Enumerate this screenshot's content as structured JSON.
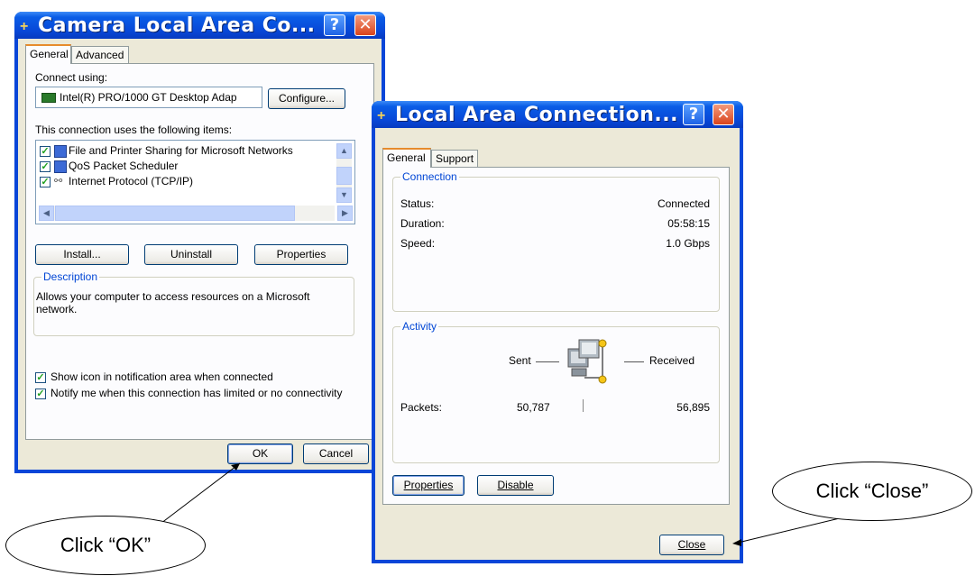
{
  "dialog1": {
    "title": "Camera Local Area Co...",
    "help_label": "?",
    "close_label": "✕",
    "tabs": [
      "General",
      "Advanced"
    ],
    "connect_using_label": "Connect using:",
    "adapter_name": "Intel(R) PRO/1000 GT Desktop Adap",
    "configure_label": "Configure...",
    "items_label": "This connection uses the following items:",
    "items": [
      "File and Printer Sharing for Microsoft Networks",
      "QoS Packet Scheduler",
      "Internet Protocol (TCP/IP)"
    ],
    "install_label": "Install...",
    "uninstall_label": "Uninstall",
    "properties_label": "Properties",
    "description_title": "Description",
    "description_text_line1": "Allows your computer to access resources on a Microsoft",
    "description_text_line2": "network.",
    "show_icon_label": "Show icon in notification area when connected",
    "notify_label": "Notify me when this connection has limited or no connectivity",
    "ok_label": "OK",
    "cancel_label": "Cancel"
  },
  "dialog2": {
    "title": "Local Area Connection...",
    "help_label": "?",
    "close_label": "✕",
    "tabs": [
      "General",
      "Support"
    ],
    "connection_title": "Connection",
    "status_label": "Status:",
    "status_value": "Connected",
    "duration_label": "Duration:",
    "duration_value": "05:58:15",
    "speed_label": "Speed:",
    "speed_value": "1.0 Gbps",
    "activity_title": "Activity",
    "sent_label": "Sent",
    "received_label": "Received",
    "packets_label": "Packets:",
    "packets_sent": "50,787",
    "packets_received": "56,895",
    "properties_label": "Properties",
    "disable_label": "Disable",
    "close_button_label": "Close"
  },
  "callouts": {
    "ok": "Click “OK”",
    "close": "Click “Close”"
  },
  "colors": {
    "titlebar": "#0a5de6",
    "dialog_bg": "#ece9d8",
    "group_title": "#0046d5"
  }
}
